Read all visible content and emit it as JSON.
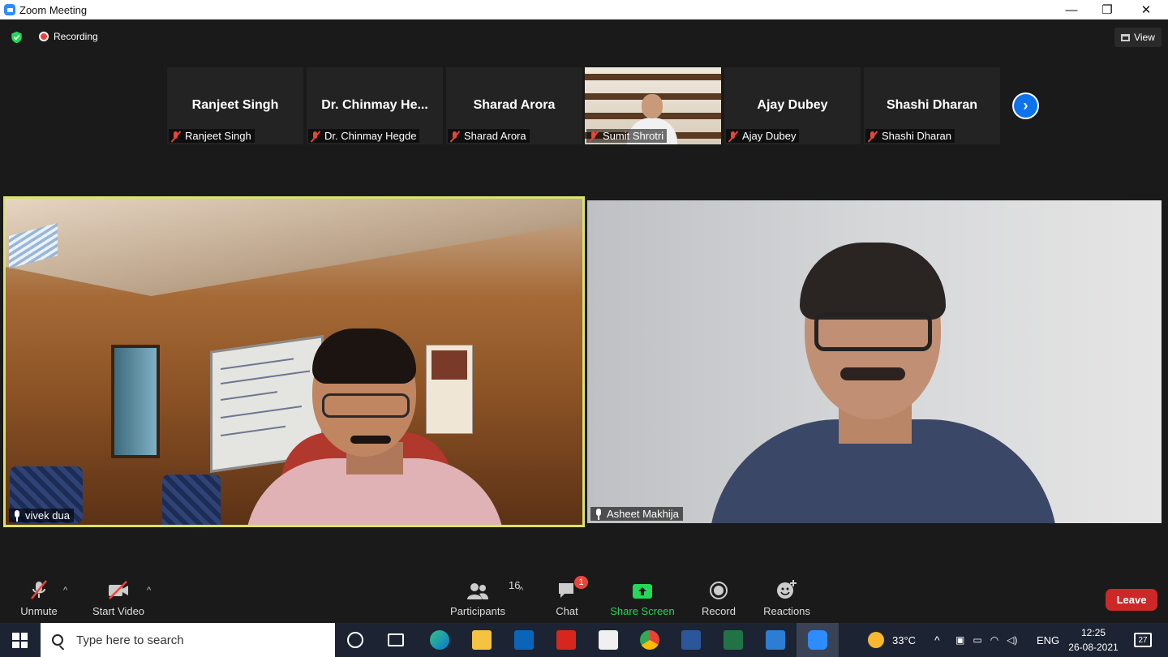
{
  "window": {
    "title": "Zoom Meeting",
    "minimize": "—",
    "restore": "❐",
    "close": "✕"
  },
  "top": {
    "recording": "Recording",
    "view": "View"
  },
  "gallery": [
    {
      "big": "Ranjeet Singh",
      "label": "Ranjeet Singh"
    },
    {
      "big": "Dr. Chinmay  He...",
      "label": "Dr. Chinmay Hegde"
    },
    {
      "big": "Sharad Arora",
      "label": "Sharad Arora"
    },
    {
      "big": "",
      "label": "Sumit Shrotri"
    },
    {
      "big": "Ajay Dubey",
      "label": "Ajay Dubey"
    },
    {
      "big": "Shashi Dharan",
      "label": "Shashi Dharan"
    }
  ],
  "videos": {
    "left_name": "vivek dua",
    "right_name": "Asheet Makhija"
  },
  "controls": {
    "unmute": "Unmute",
    "start_video": "Start Video",
    "participants": "Participants",
    "participants_count": "16",
    "chat": "Chat",
    "chat_badge": "1",
    "share_screen": "Share Screen",
    "record": "Record",
    "reactions": "Reactions",
    "leave": "Leave"
  },
  "taskbar": {
    "search_placeholder": "Type here to search",
    "weather": "33°C",
    "language": "ENG",
    "time": "12:25",
    "date": "26-08-2021",
    "notifications": "27"
  },
  "colors": {
    "accent": "#2d8cff",
    "active_speaker": "#d7e36e",
    "share_green": "#23d959",
    "leave_red": "#cc2828"
  }
}
